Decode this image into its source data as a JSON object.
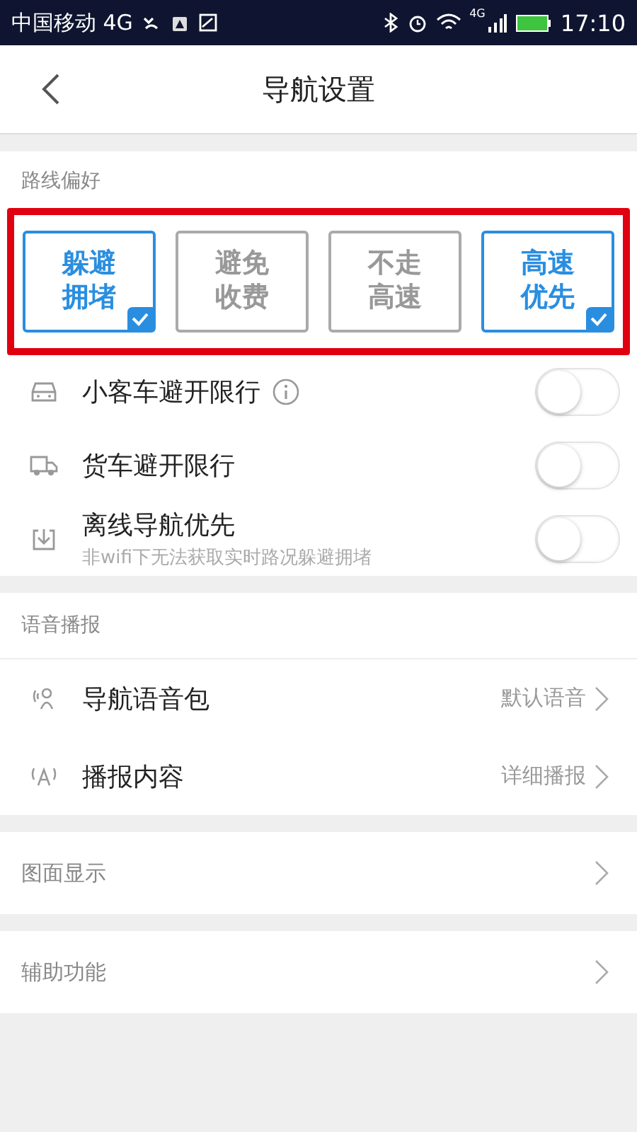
{
  "status_bar": {
    "carrier": "中国移动 4G",
    "network_badge": "4G",
    "time": "17:10"
  },
  "header": {
    "title": "导航设置"
  },
  "route_preferences": {
    "label": "路线偏好",
    "options": [
      {
        "label": "躲避拥堵",
        "selected": true
      },
      {
        "label": "避免收费",
        "selected": false
      },
      {
        "label": "不走高速",
        "selected": false
      },
      {
        "label": "高速优先",
        "selected": true
      }
    ]
  },
  "route_settings": [
    {
      "kind": "car",
      "label": "小客车避开限行",
      "info": true,
      "on": false
    },
    {
      "kind": "truck",
      "label": "货车避开限行",
      "on": false
    },
    {
      "kind": "offline",
      "label": "离线导航优先",
      "subtitle": "非wifi下无法获取实时路况躲避拥堵",
      "on": false
    }
  ],
  "voice": {
    "label": "语音播报",
    "items": [
      {
        "kind": "voice_pack",
        "label": "导航语音包",
        "value": "默认语音"
      },
      {
        "kind": "broadcast",
        "label": "播报内容",
        "value": "详细播报"
      }
    ]
  },
  "more": [
    {
      "label": "图面显示"
    },
    {
      "label": "辅助功能"
    }
  ]
}
